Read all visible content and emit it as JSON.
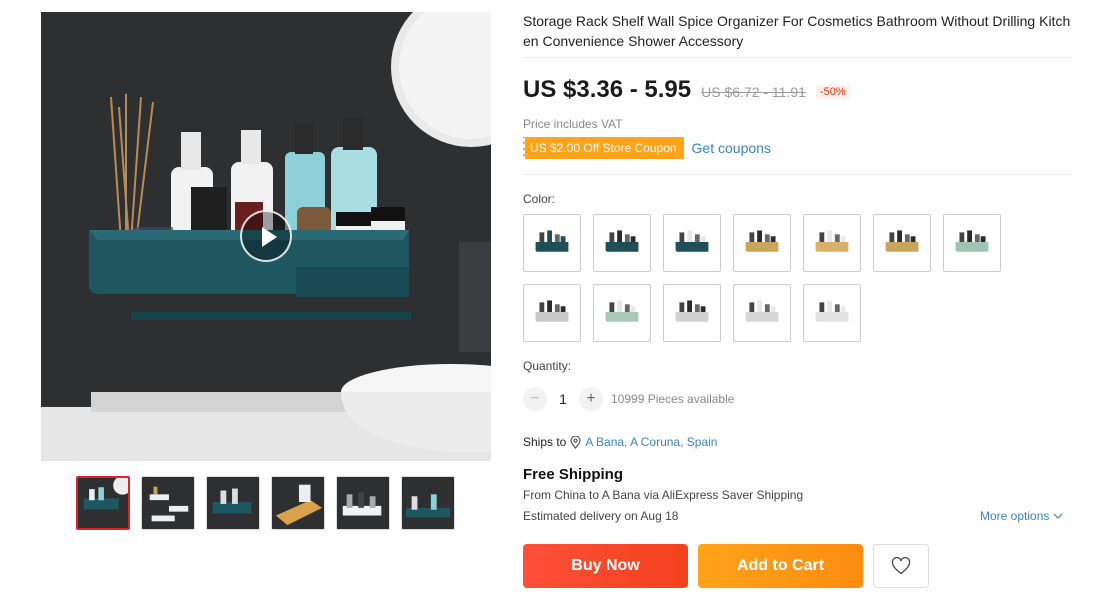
{
  "product": {
    "title": "Storage Rack Shelf Wall Spice Organizer For Cosmetics Bathroom Without Drilling Kitchen Convenience Shower Accessory",
    "price": "US $3.36 - 5.95",
    "original_price": "US $6.72 - 11.91",
    "discount": "-50%",
    "vat_note": "Price includes VAT",
    "coupon_label": "US $2.00 Off Store Coupon",
    "get_coupons": "Get coupons"
  },
  "gallery": {
    "video_button": "play-icon",
    "thumbnails": 6,
    "active_thumbnail": 1
  },
  "options": {
    "color_label": "Color:",
    "colors": [
      {
        "base": "#1f4e57",
        "accent": "#1f4e57"
      },
      {
        "base": "#1f4e57",
        "accent": "#2b2b2b"
      },
      {
        "base": "#1f4e57",
        "accent": "#e8e8e8"
      },
      {
        "base": "#c9a55c",
        "accent": "#2b2b2b"
      },
      {
        "base": "#d9b06a",
        "accent": "#e8e8e8"
      },
      {
        "base": "#c9a55c",
        "accent": "#2b2b2b"
      },
      {
        "base": "#9fc4b3",
        "accent": "#2b2b2b"
      },
      {
        "base": "#c8c8c8",
        "accent": "#2b2b2b"
      },
      {
        "base": "#a8c9b8",
        "accent": "#e8e8e8"
      },
      {
        "base": "#d0d0d0",
        "accent": "#2b2b2b"
      },
      {
        "base": "#d6d6d6",
        "accent": "#e8e8e8"
      },
      {
        "base": "#e2e2e2",
        "accent": "#e8e8e8"
      }
    ]
  },
  "quantity": {
    "label": "Quantity:",
    "value": "1",
    "minus": "−",
    "plus": "+",
    "available": "10999 Pieces available"
  },
  "shipping": {
    "ships_to_label": "Ships to",
    "location": "A Bana, A Coruna, Spain",
    "free_shipping": "Free Shipping",
    "route": "From China to A Bana via AliExpress Saver Shipping",
    "delivery": "Estimated delivery on Aug 18",
    "more_options": "More options"
  },
  "actions": {
    "buy_now": "Buy Now",
    "add_to_cart": "Add to Cart",
    "wishlist_icon": "heart-icon"
  },
  "colors": {
    "buy": "#f2421d",
    "cart": "#fb8c10",
    "link": "#3b83c4",
    "coupon": "#ffa31a",
    "discount": "#e62e04"
  }
}
